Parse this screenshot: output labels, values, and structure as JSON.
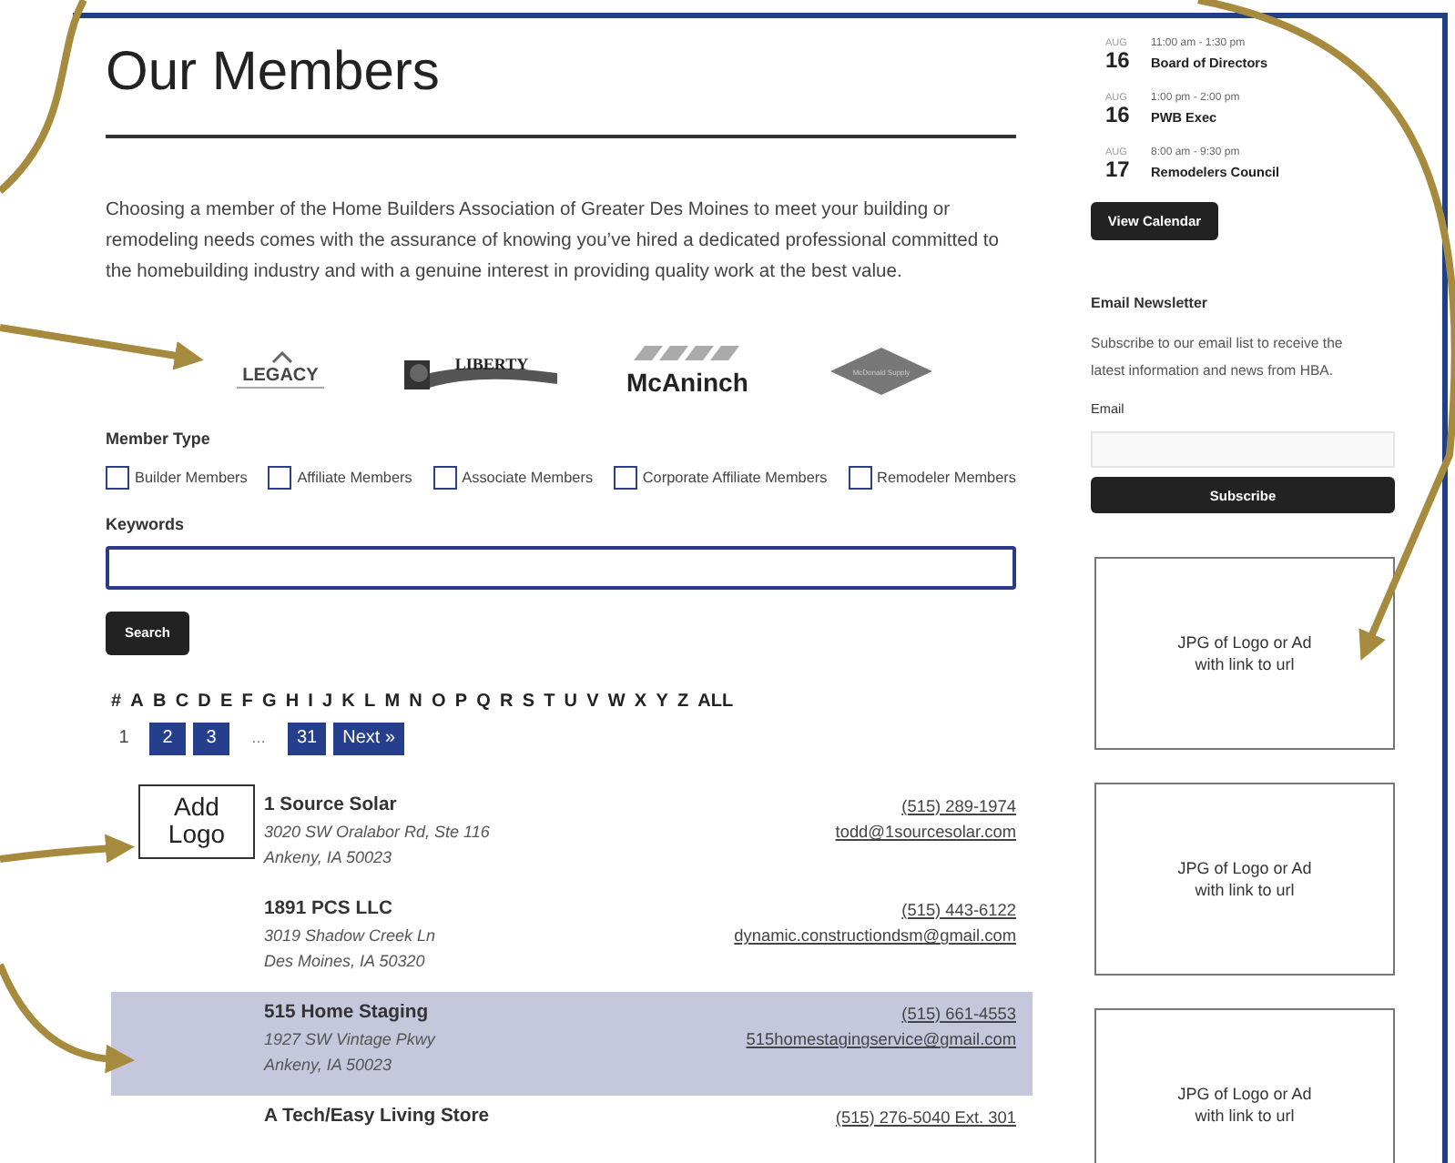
{
  "page": {
    "title": "Our Members",
    "intro": "Choosing a member of the Home Builders Association of Greater Des Moines to meet your building or remodeling needs comes with the assurance of knowing you’ve hired a dedicated professional committed to the homebuilding industry and with a genuine interest in providing quality work at the best value."
  },
  "logos": [
    {
      "kind": "legacy",
      "text": "LEGACY"
    },
    {
      "kind": "liberty",
      "text": "LIBERTY"
    },
    {
      "kind": "mcaninch",
      "text": "McAninch"
    },
    {
      "kind": "diamond",
      "text": "McDonald Supply"
    }
  ],
  "filters": {
    "member_type_label": "Member Type",
    "options": [
      {
        "label": "Builder Members",
        "checked": false
      },
      {
        "label": "Affiliate Members",
        "checked": false
      },
      {
        "label": "Associate Members",
        "checked": false
      },
      {
        "label": "Corporate Affiliate Members",
        "checked": false
      },
      {
        "label": "Remodeler Members",
        "checked": false
      }
    ],
    "keywords_label": "Keywords",
    "search_button": "Search"
  },
  "letters": [
    "#",
    "A",
    "B",
    "C",
    "D",
    "E",
    "F",
    "G",
    "H",
    "I",
    "J",
    "K",
    "L",
    "M",
    "N",
    "O",
    "P",
    "Q",
    "R",
    "S",
    "T",
    "U",
    "V",
    "W",
    "X",
    "Y",
    "Z",
    "ALL"
  ],
  "pagination": [
    {
      "kind": "page",
      "label": "1",
      "selected": true
    },
    {
      "kind": "page",
      "label": "2",
      "selected": false
    },
    {
      "kind": "page",
      "label": "3",
      "selected": false
    },
    {
      "kind": "ellipsis",
      "label": "…"
    },
    {
      "kind": "page",
      "label": "31",
      "selected": false
    },
    {
      "kind": "next",
      "label": "Next »",
      "selected": false
    }
  ],
  "members": [
    {
      "name": "1 Source Solar",
      "address": [
        "3020 SW Oralabor Rd, Ste 116",
        "Ankeny, IA 50023"
      ],
      "phone": "(515) 289-1974",
      "email": "todd@1sourcesolar.com",
      "logo": "Add Logo",
      "highlighted": false
    },
    {
      "name": "1891 PCS LLC",
      "address": [
        "3019 Shadow Creek Ln",
        "Des Moines, IA 50320"
      ],
      "phone": "(515) 443-6122",
      "email": "dynamic.constructiondsm@gmail.com",
      "highlighted": false
    },
    {
      "name": "515 Home Staging",
      "address": [
        "1927 SW Vintage Pkwy",
        "Ankeny, IA 50023"
      ],
      "phone": "(515) 661-4553",
      "email": "515homestagingservice@gmail.com",
      "highlighted": true
    },
    {
      "name": "A Tech/Easy Living Store",
      "phone": "(515) 276-5040 Ext. 301",
      "highlighted": false
    }
  ],
  "sidebar": {
    "events": [
      {
        "month": "AUG",
        "day": "16",
        "time": "11:00 am - 1:30 pm",
        "title": "Board of Directors"
      },
      {
        "month": "AUG",
        "day": "16",
        "time": "1:00 pm - 2:00 pm",
        "title": "PWB Exec"
      },
      {
        "month": "AUG",
        "day": "17",
        "time": "8:00 am - 9:30 pm",
        "title": "Remodelers Council"
      }
    ],
    "calendar_button": "View Calendar",
    "newsletter_title": "Email Newsletter",
    "newsletter_text": "Subscribe to our email list to receive the latest information and news from HBA.",
    "email_label": "Email",
    "subscribe_button": "Subscribe",
    "ads": [
      "JPG of Logo or Ad with link to url",
      "JPG of Logo or Ad with link to url",
      "JPG of Logo or Ad with link to url"
    ]
  }
}
